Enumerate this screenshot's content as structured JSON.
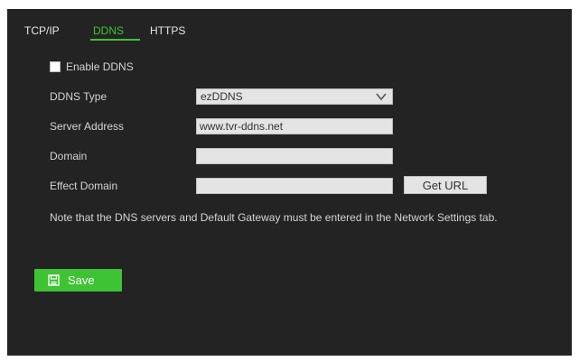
{
  "tabs": [
    {
      "label": "TCP/IP",
      "active": false
    },
    {
      "label": "DDNS",
      "active": true
    },
    {
      "label": "HTTPS",
      "active": false
    }
  ],
  "form": {
    "enable_ddns": {
      "label": "Enable DDNS",
      "checked": false
    },
    "ddns_type": {
      "label": "DDNS Type",
      "value": "ezDDNS"
    },
    "server_address": {
      "label": "Server Address",
      "value": "www.tvr-ddns.net"
    },
    "domain": {
      "label": "Domain",
      "value": ""
    },
    "effect_domain": {
      "label": "Effect Domain",
      "value": ""
    }
  },
  "get_url_label": "Get URL",
  "note": "Note that the DNS servers and Default Gateway must be entered in the Network Settings tab.",
  "save_label": "Save",
  "colors": {
    "panel_bg": "#232323",
    "accent": "#3ec334",
    "text": "#d4d4d4",
    "input_bg": "#e4e4e4"
  },
  "icons": {
    "dropdown": "chevron-down-icon",
    "save": "floppy-disk-icon"
  }
}
